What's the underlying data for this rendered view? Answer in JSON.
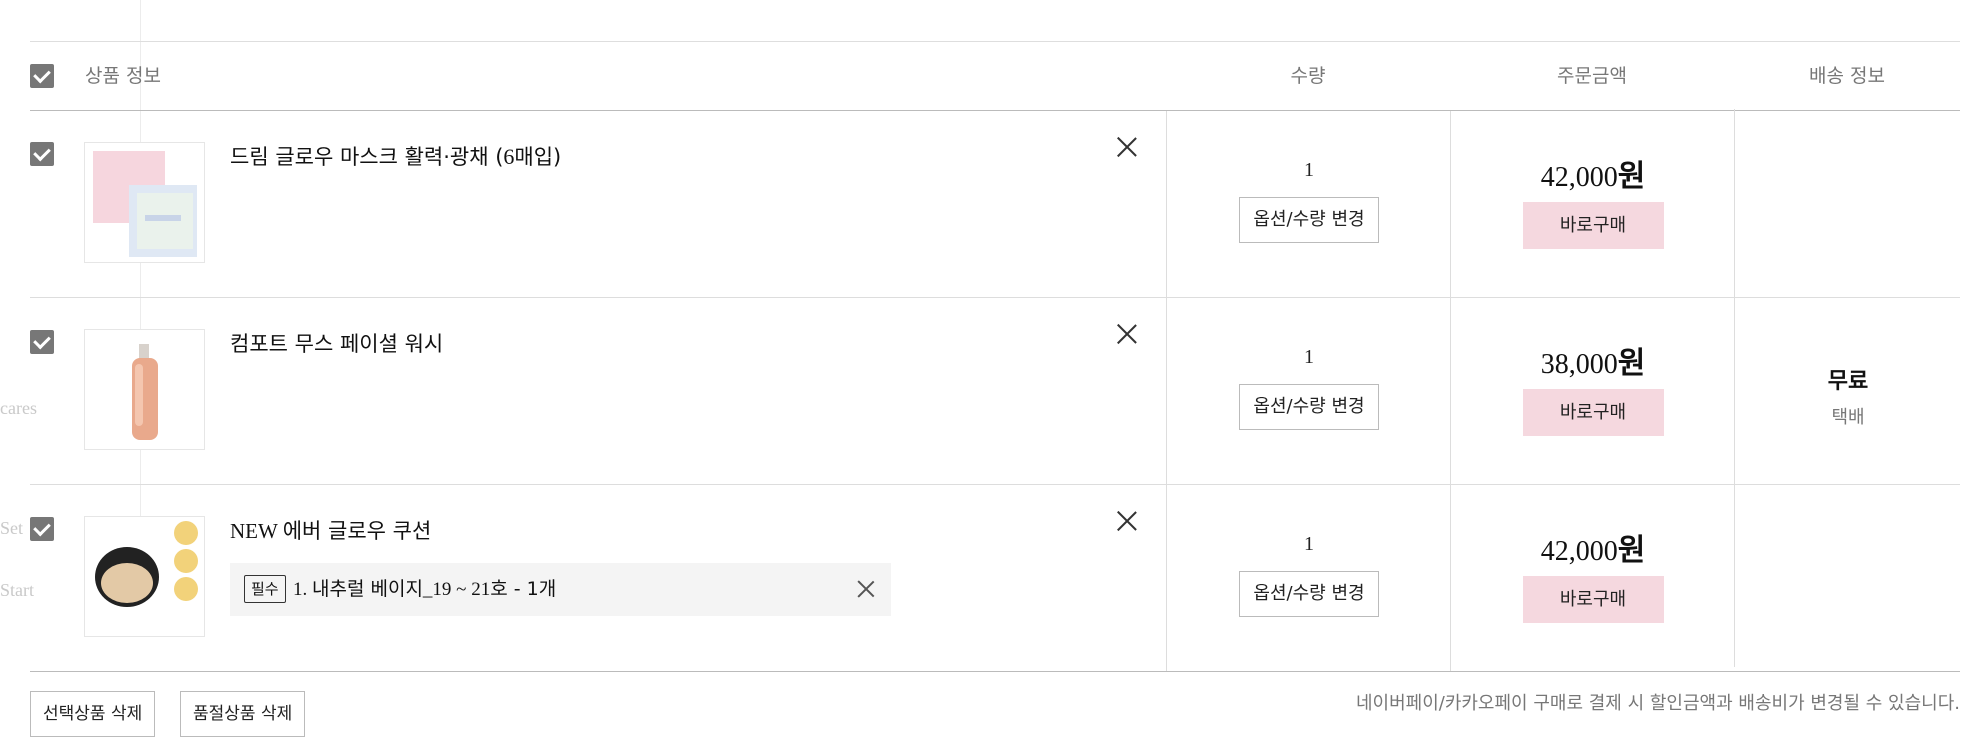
{
  "background_fragments": [
    "cares",
    "Set",
    "Start"
  ],
  "header": {
    "product_info": "상품 정보",
    "quantity": "수량",
    "order_amount": "주문금액",
    "shipping_info": "배송 정보"
  },
  "items": [
    {
      "name_pre": "드림 글로우 마스크 활력·광채 (",
      "name_num": "6",
      "name_post": "매입)",
      "quantity": "1",
      "option_button": "옵션/수량 변경",
      "price_amount": "42,000",
      "price_unit": "원",
      "buy_button": "바로구매"
    },
    {
      "name_pre": "컴포트 무스 페이셜 워시",
      "name_num": "",
      "name_post": "",
      "quantity": "1",
      "option_button": "옵션/수량 변경",
      "price_amount": "38,000",
      "price_unit": "원",
      "buy_button": "바로구매"
    },
    {
      "name_pre": "NEW ",
      "name_num": "",
      "name_post": "에버 글로우 쿠션",
      "quantity": "1",
      "option_button": "옵션/수량 변경",
      "price_amount": "42,000",
      "price_unit": "원",
      "buy_button": "바로구매",
      "option": {
        "badge": "필수",
        "prefix": "1. ",
        "name": "내추럴 베이지",
        "detail": "_19 ~ 21",
        "suffix": "호 - 1",
        "count_unit": "개"
      }
    }
  ],
  "shipping": {
    "fee": "무료",
    "method": "택배"
  },
  "footer": {
    "delete_selected": "선택상품 삭제",
    "delete_soldout": "품절상품 삭제",
    "notice": "네이버페이/카카오페이 구매로 결제 시 할인금액과 배송비가 변경될 수 있습니다."
  },
  "colors": {
    "checkbox": "#777777",
    "buy_button_bg": "#f5d8df",
    "muted_text": "#777777"
  },
  "icons": [
    "checkbox-checked-icon",
    "close-x-icon"
  ]
}
